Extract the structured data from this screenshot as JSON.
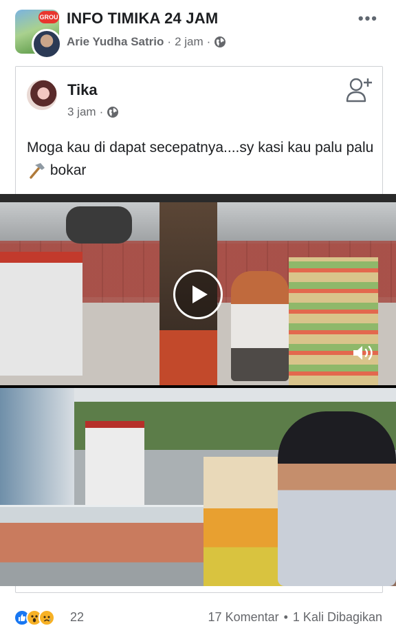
{
  "post": {
    "group_name": "INFO TIMIKA 24 JAM",
    "group_badge": "GROU",
    "author": "Arie Yudha Satrio",
    "time": "2 jam",
    "separator": "·",
    "more_label": "•••"
  },
  "shared": {
    "author": "Tika",
    "time": "3 jam",
    "separator": "·",
    "text_part1": "Moga kau di dapat secepatnya....sy kasi kau palu palu",
    "text_part2": "bokar"
  },
  "footer": {
    "reaction_count": "22",
    "comments": "17 Komentar",
    "dot": "•",
    "shares": "1 Kali Dibagikan"
  },
  "icons": {
    "privacy": "globe-icon",
    "more": "more-icon",
    "add_friend": "add-friend-icon",
    "hammer": "hammer-icon",
    "volume": "volume-icon",
    "play": "play-icon"
  },
  "colors": {
    "text_primary": "#1c1e21",
    "text_secondary": "#65676b",
    "like_blue": "#1877f2",
    "reaction_yellow": "#f7b125"
  }
}
